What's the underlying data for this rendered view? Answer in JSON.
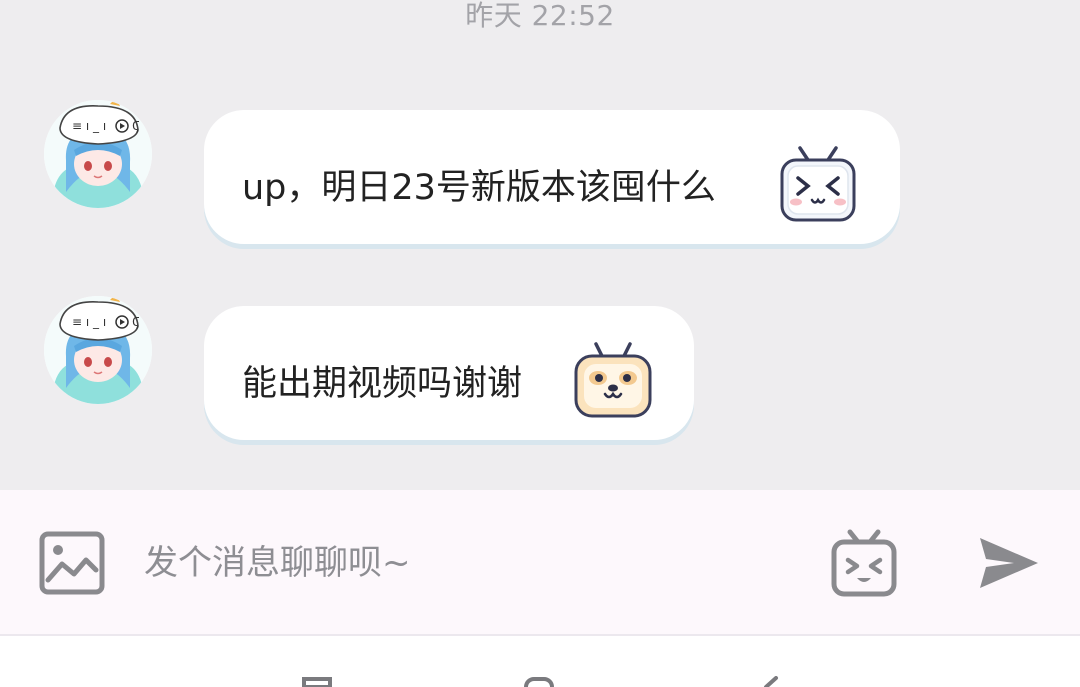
{
  "chat": {
    "timestamp": "昨天 22:52",
    "messages": [
      {
        "text": "up，明日23号新版本该囤什么",
        "sticker": "tv-squint-sticker"
      },
      {
        "text": "能出期视频吗谢谢",
        "sticker": "tv-dog-sticker"
      }
    ]
  },
  "input": {
    "placeholder": "发个消息聊聊呗~",
    "value": "",
    "image_icon": "image-icon",
    "emoji_icon": "tv-emoji-icon",
    "send_icon": "send-icon"
  },
  "colors": {
    "background": "#eeedef",
    "bubble": "#ffffff",
    "input_bar": "#fdf8fc",
    "icon_gray": "#8a8a8e"
  }
}
